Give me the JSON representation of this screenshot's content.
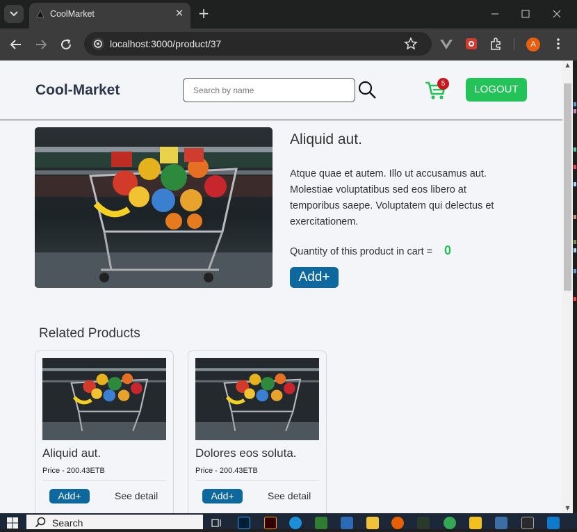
{
  "browser": {
    "tab_title": "CoolMarket",
    "tab_close": "✕",
    "new_tab": "+",
    "url": "localhost:3000/product/37",
    "profile_initial": "A"
  },
  "header": {
    "brand": "Cool-Market",
    "search_placeholder": "Search by name",
    "cart_count": "5",
    "logout_label": "LOGOUT"
  },
  "product": {
    "name": "Aliquid aut.",
    "description": "Atque quae et autem. Illo ut accusamus aut. Molestiae voluptatibus sed eos libero at temporibus saepe. Voluptatem qui delectus et exercitationem.",
    "qty_label": "Quantity of this product in cart =",
    "qty_value": "0",
    "add_label": "Add+"
  },
  "related": {
    "title": "Related Products",
    "items": [
      {
        "name": "Aliquid aut.",
        "price": "Price - 200.43ETB",
        "add_label": "Add+",
        "detail_label": "See detail"
      },
      {
        "name": "Dolores eos soluta.",
        "price": "Price - 200.43ETB",
        "add_label": "Add+",
        "detail_label": "See detail"
      }
    ]
  },
  "taskbar": {
    "search_label": "Search"
  },
  "colors": {
    "accent_green": "#23c35a",
    "button_blue": "#0d689e",
    "badge_red": "#c8171e",
    "brand_text": "#2c3549"
  }
}
